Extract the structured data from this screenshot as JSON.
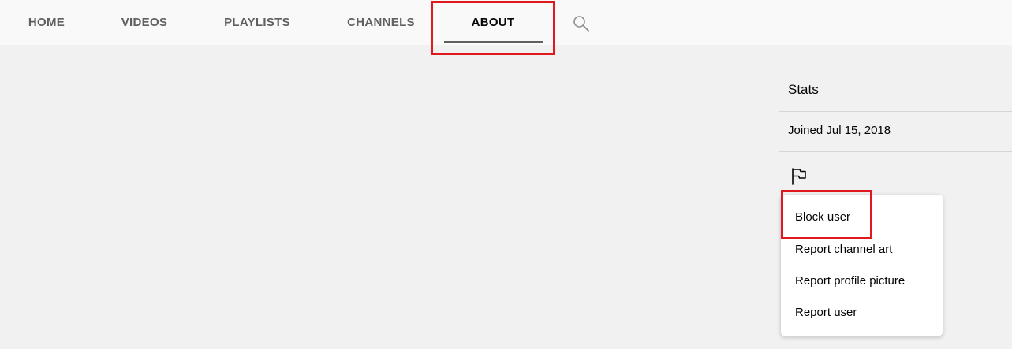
{
  "tabs": [
    {
      "label": "HOME"
    },
    {
      "label": "VIDEOS"
    },
    {
      "label": "PLAYLISTS"
    },
    {
      "label": "CHANNELS"
    },
    {
      "label": "ABOUT",
      "active": true
    }
  ],
  "search": {
    "icon": "search-icon"
  },
  "stats": {
    "title": "Stats",
    "joined": "Joined Jul 15, 2018",
    "flag_icon": "flag-icon"
  },
  "menu": {
    "items": [
      {
        "label": "Block user"
      },
      {
        "label": "Report channel art"
      },
      {
        "label": "Report profile picture"
      },
      {
        "label": "Report user"
      }
    ]
  },
  "colors": {
    "highlight": "#e0191e",
    "active_tab_text": "#030303",
    "inactive_tab_text": "#606060",
    "page_bg": "#f1f1f1",
    "tabs_bg": "#f9f9f9"
  }
}
